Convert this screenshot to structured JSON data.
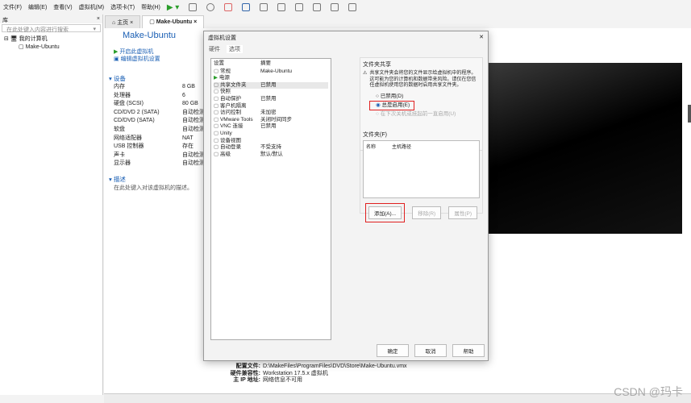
{
  "menubar": {
    "items": [
      "文件(F)",
      "编辑(E)",
      "查看(V)",
      "虚拟机(M)",
      "选项卡(T)",
      "帮助(H)"
    ]
  },
  "library": {
    "title": "库",
    "close": "×",
    "search_placeholder": "在此处键入内容进行搜索",
    "tree": {
      "root": "我的计算机",
      "child": "Make-Ubuntu"
    }
  },
  "tabs": [
    {
      "label": "主页"
    },
    {
      "label": "Make-Ubuntu"
    }
  ],
  "vm": {
    "title": "Make-Ubuntu",
    "actions": [
      "开启此虚拟机",
      "编辑虚拟机设置"
    ],
    "devices_title": "设备",
    "devices": [
      [
        "内存",
        "8 GB"
      ],
      [
        "处理器",
        "6"
      ],
      [
        "硬盘 (SCSI)",
        "80 GB"
      ],
      [
        "CD/DVD 2 (SATA)",
        "自动检测"
      ],
      [
        "CD/DVD (SATA)",
        "自动检测"
      ],
      [
        "软盘",
        "自动检测"
      ],
      [
        "网络适配器",
        "NAT"
      ],
      [
        "USB 控制器",
        "存在"
      ],
      [
        "声卡",
        "自动检测"
      ],
      [
        "显示器",
        "自动检测"
      ]
    ],
    "desc_title": "描述",
    "desc_placeholder": "在此处键入对该虚拟机的描述。",
    "details": [
      [
        "配置文件:",
        "D:\\MakeFiles\\ProgramFiles\\DVD\\Store\\Make-Ubuntu.vmx"
      ],
      [
        "硬件兼容性:",
        "Workstation 17.5.x 虚拟机"
      ],
      [
        "主 IP 地址:",
        "网络信息不可用"
      ]
    ]
  },
  "dialog": {
    "title": "虚拟机设置",
    "tabs": [
      "硬件",
      "选项"
    ],
    "col_setting": "设置",
    "col_summary": "摘要",
    "options": [
      [
        "常规",
        "Make-Ubuntu"
      ],
      [
        "电源",
        ""
      ],
      [
        "共享文件夹",
        "已禁用"
      ],
      [
        "快照",
        ""
      ],
      [
        "自动保护",
        "已禁用"
      ],
      [
        "客户机隔离",
        ""
      ],
      [
        "访问控制",
        "未加密"
      ],
      [
        "VMware Tools",
        "关闭时间同步"
      ],
      [
        "VNC 连接",
        "已禁用"
      ],
      [
        "Unity",
        ""
      ],
      [
        "设备视图",
        ""
      ],
      [
        "自动登录",
        "不受支持"
      ],
      [
        "高级",
        "默认/默认"
      ]
    ],
    "share_title": "文件夹共享",
    "warning": "共享文件夹会将您的文件显示给虚拟机中的程序。这可能为您的计算机和数据带来风险。请仅在您信任虚拟机使用您的数据时启用共享文件夹。",
    "radios": [
      {
        "label": "已禁用(D)",
        "checked": false
      },
      {
        "label": "总是启用(E)",
        "checked": true
      },
      {
        "label": "在下次关机或挂起前一直启用(U)",
        "checked": false,
        "disabled": true
      }
    ],
    "folders_title": "文件夹(F)",
    "folders_cols": [
      "名称",
      "主机路径"
    ],
    "add": "添加(A)...",
    "remove": "移除(R)",
    "props": "属性(P)",
    "ok": "确定",
    "cancel": "取消",
    "help": "帮助"
  },
  "watermark": "CSDN @玛卡"
}
